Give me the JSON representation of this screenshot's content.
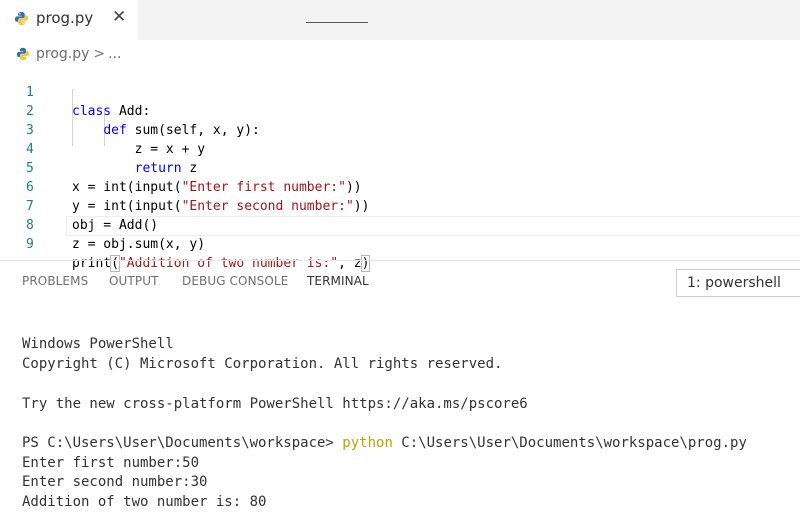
{
  "tab": {
    "filename": "prog.py",
    "close_glyph": "✕"
  },
  "breadcrumb": {
    "file": "prog.py",
    "separator": ">",
    "more": "..."
  },
  "editor": {
    "lines": [
      {
        "num": "1",
        "code": "class Add:"
      },
      {
        "num": "2",
        "code": "    def sum(self, x, y):"
      },
      {
        "num": "3",
        "code": "        z = x + y"
      },
      {
        "num": "4",
        "code": "        return z"
      },
      {
        "num": "5",
        "code": "x = int(input(\"Enter first number:\"))"
      },
      {
        "num": "6",
        "code": "y = int(input(\"Enter second number:\"))"
      },
      {
        "num": "7",
        "code": "obj = Add()"
      },
      {
        "num": "8",
        "code": "z = obj.sum(x, y)"
      },
      {
        "num": "9",
        "code": "print(\"Addition of two number is:\", z)"
      }
    ]
  },
  "panel": {
    "tabs": [
      "PROBLEMS",
      "OUTPUT",
      "DEBUG CONSOLE",
      "TERMINAL"
    ],
    "active_tab": "TERMINAL",
    "shell": "1: powershell"
  },
  "terminal": {
    "line1": "Windows PowerShell",
    "line2": "Copyright (C) Microsoft Corporation. All rights reserved.",
    "line3": "Try the new cross-platform PowerShell https://aka.ms/pscore6",
    "prompt": "PS C:\\Users\\User\\Documents\\workspace> ",
    "command": "python",
    "command_arg": " C:\\Users\\User\\Documents\\workspace\\prog.py",
    "out1": "Enter first number:50",
    "out2": "Enter second number:30",
    "out3": "Addition of two number is: 80"
  },
  "colors": {
    "keyword": "#0000ff",
    "string": "#a31515",
    "line_number": "#237893",
    "python_command": "#b8a700",
    "python_icon_blue": "#3572a5",
    "python_icon_yellow": "#f2c73b"
  },
  "icons": {
    "file_icon": "python-file-icon"
  }
}
